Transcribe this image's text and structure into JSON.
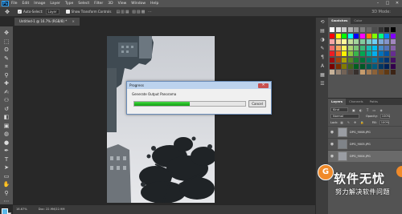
{
  "menubar": {
    "logo": "Ps",
    "items": [
      "File",
      "Edit",
      "Image",
      "Layer",
      "Type",
      "Select",
      "Filter",
      "3D",
      "View",
      "Window",
      "Help"
    ],
    "window_controls": [
      "–",
      "□",
      "✕"
    ]
  },
  "options": {
    "auto_select_label": "Auto-Select:",
    "auto_select_value": "Layer",
    "show_transform_label": "Show Transform Controls",
    "mode_3d": "3D Mode:"
  },
  "document_tab": {
    "title": "Untitled-1 @ 16.7% (RGB/8) *",
    "close": "×"
  },
  "status": {
    "zoom": "16.67%",
    "doc_size": "Doc: 22.9M/22.9M"
  },
  "panels": {
    "swatches_tabs": [
      "Swatches",
      "Color"
    ],
    "layers_tabs": [
      "Layers",
      "Channels",
      "Paths"
    ],
    "kind_label": "Kind",
    "blend_mode": "Normal",
    "opacity_label": "Opacity:",
    "opacity_value": "100%",
    "lock_label": "Lock:",
    "fill_label": "Fill:",
    "fill_value": "100%",
    "layers": [
      "DPG_9008.JPG",
      "DPG_9005.JPG",
      "DPG_9004.JPG"
    ],
    "swatch_colors": [
      "#ffffff",
      "#e6e6e6",
      "#cccccc",
      "#b3b3b3",
      "#999999",
      "#808080",
      "#666666",
      "#4d4d4d",
      "#333333",
      "#1a1a1a",
      "#000000",
      "#ff0000",
      "#ffff00",
      "#00ff00",
      "#00ffff",
      "#0000ff",
      "#ff00ff",
      "#ff8000",
      "#80ff00",
      "#00ff80",
      "#0080ff",
      "#8000ff",
      "#f4a6a6",
      "#f9d59b",
      "#fff79a",
      "#c4df9b",
      "#a2d39c",
      "#82ca9d",
      "#7bcdc8",
      "#6ecff6",
      "#7ea7d8",
      "#8493ca",
      "#a187be",
      "#ef6c6c",
      "#f5a85d",
      "#fff35d",
      "#acd373",
      "#7cc576",
      "#3bb878",
      "#1abbb4",
      "#00bff3",
      "#438ccb",
      "#5574b9",
      "#8560a8",
      "#ed1c24",
      "#f26522",
      "#fff200",
      "#8dc63f",
      "#39b54a",
      "#00a651",
      "#00a99d",
      "#00aeef",
      "#0072bc",
      "#0054a6",
      "#662d91",
      "#9e0b0f",
      "#a0410d",
      "#aba000",
      "#598527",
      "#1a7b30",
      "#007236",
      "#00746b",
      "#0076a3",
      "#004b80",
      "#003471",
      "#440e62",
      "#790000",
      "#7b2e00",
      "#827b00",
      "#406618",
      "#005e20",
      "#005826",
      "#005952",
      "#005b7f",
      "#003663",
      "#002157",
      "#32004b",
      "#c7b299",
      "#998675",
      "#736357",
      "#534741",
      "#37302d",
      "#c69c6d",
      "#a67c52",
      "#8c6239",
      "#754c24",
      "#603913",
      "#3c2415"
    ]
  },
  "dialog": {
    "title": "Progress",
    "close": "✕",
    "message": "Generate Output Panorama",
    "progress": 0.5,
    "cancel_label": "Cancel"
  },
  "watermark": {
    "logo": "G",
    "title": "软件无忧",
    "subtitle": "努力解决软件问题"
  },
  "colors": {
    "foreground": "#5bb8e8",
    "background": "#e8e8e8",
    "progress_green": "#22b822"
  }
}
